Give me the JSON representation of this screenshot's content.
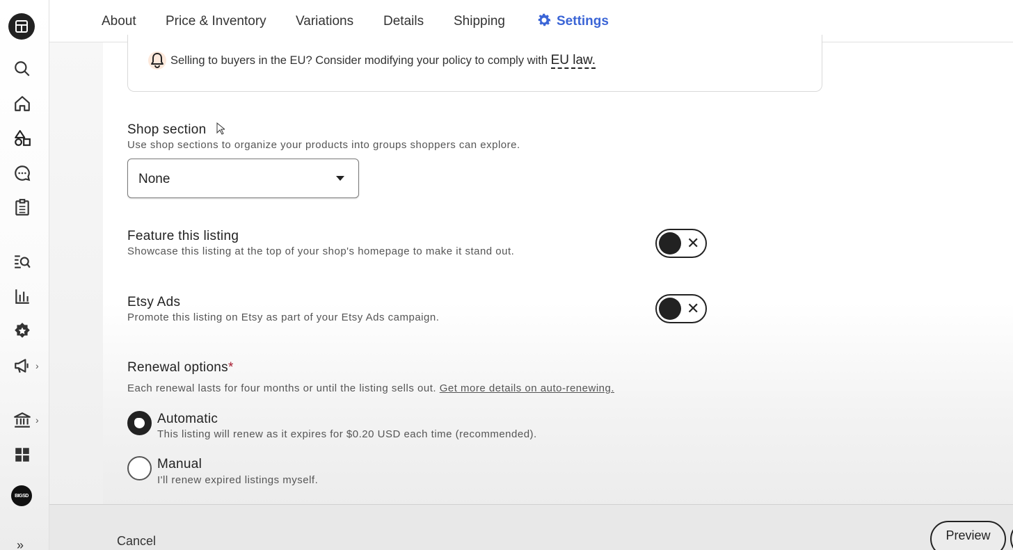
{
  "sidebar": {
    "avatar_text": "BIGSD",
    "icons": [
      "shop-logo-icon",
      "search-icon",
      "home-icon",
      "listings-icon",
      "messages-icon",
      "orders-icon",
      "marketing-search-icon",
      "stats-icon",
      "star-seller-icon",
      "marketing-icon",
      "finances-icon",
      "apps-icon"
    ]
  },
  "tabs": [
    {
      "label": "About"
    },
    {
      "label": "Price & Inventory"
    },
    {
      "label": "Variations"
    },
    {
      "label": "Details"
    },
    {
      "label": "Shipping"
    },
    {
      "label": "Settings"
    }
  ],
  "eu_notice": {
    "text": "Selling to buyers in the EU? Consider modifying your policy to comply with ",
    "link": "EU law."
  },
  "shop_section": {
    "label": "Shop section",
    "description": "Use shop sections to organize your products into groups shoppers can explore.",
    "selected": "None"
  },
  "feature_listing": {
    "label": "Feature this listing",
    "description": "Showcase this listing at the top of your shop's homepage to make it stand out.",
    "enabled": false
  },
  "etsy_ads": {
    "label": "Etsy Ads",
    "description": "Promote this listing on Etsy as part of your Etsy Ads campaign.",
    "enabled": false
  },
  "renewal": {
    "label": "Renewal options",
    "required_mark": "*",
    "description": "Each renewal lasts for four months or until the listing sells out. ",
    "link": "Get more details on auto-renewing.",
    "options": [
      {
        "label": "Automatic",
        "description": "This listing will renew as it expires for $0.20 USD each time (recommended).",
        "checked": true
      },
      {
        "label": "Manual",
        "description": "I'll renew expired listings myself.",
        "checked": false
      }
    ]
  },
  "footer": {
    "cancel": "Cancel",
    "preview": "Preview"
  },
  "colors": {
    "accent": "#3b65d6",
    "required": "#a61a2e"
  }
}
